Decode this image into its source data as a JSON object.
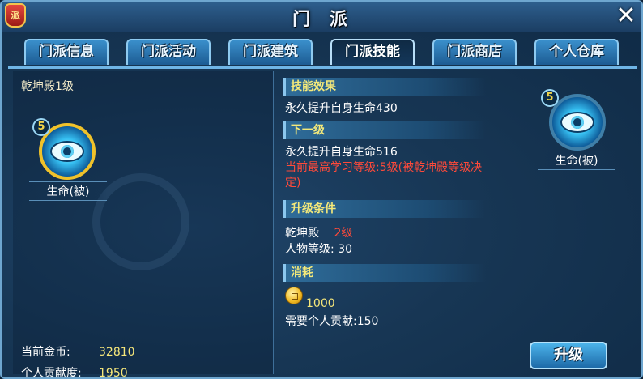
{
  "window": {
    "title": "门 派",
    "emblem_text": "派",
    "close_icon": "close-x-icon"
  },
  "tabs": [
    {
      "label": "门派信息",
      "active": false
    },
    {
      "label": "门派活动",
      "active": false
    },
    {
      "label": "门派建筑",
      "active": false
    },
    {
      "label": "门派技能",
      "active": true
    },
    {
      "label": "门派商店",
      "active": false
    },
    {
      "label": "个人仓库",
      "active": false
    }
  ],
  "left": {
    "building_level": "乾坤殿1级",
    "skill": {
      "level": "5",
      "name": "生命(被)",
      "icon": "eye-icon"
    },
    "gold_label": "当前金币:",
    "gold_value": "32810",
    "contribution_label": "个人贡献度:",
    "contribution_value": "1950"
  },
  "right": {
    "effect_header": "技能效果",
    "effect_text": "永久提升自身生命430",
    "next_header": "下一级",
    "next_text": "永久提升自身生命516",
    "max_level_note_1": "当前最高学习等级:5级(被乾坤殿等级决",
    "max_level_note_2": "定)",
    "condition_header": "升级条件",
    "condition_building": "乾坤殿",
    "condition_building_level": "2级",
    "condition_char_level": "人物等级: 30",
    "cost_header": "消耗",
    "cost_gold": "1000",
    "cost_contribution": "需要个人贡献:150"
  },
  "preview": {
    "level": "5",
    "name": "生命(被)",
    "icon": "eye-icon"
  },
  "upgrade_label": "升级",
  "colors": {
    "accent_gold": "#f4e97a",
    "warning_red": "#ff4a3a",
    "tab_blue": "#3a8fcb"
  }
}
